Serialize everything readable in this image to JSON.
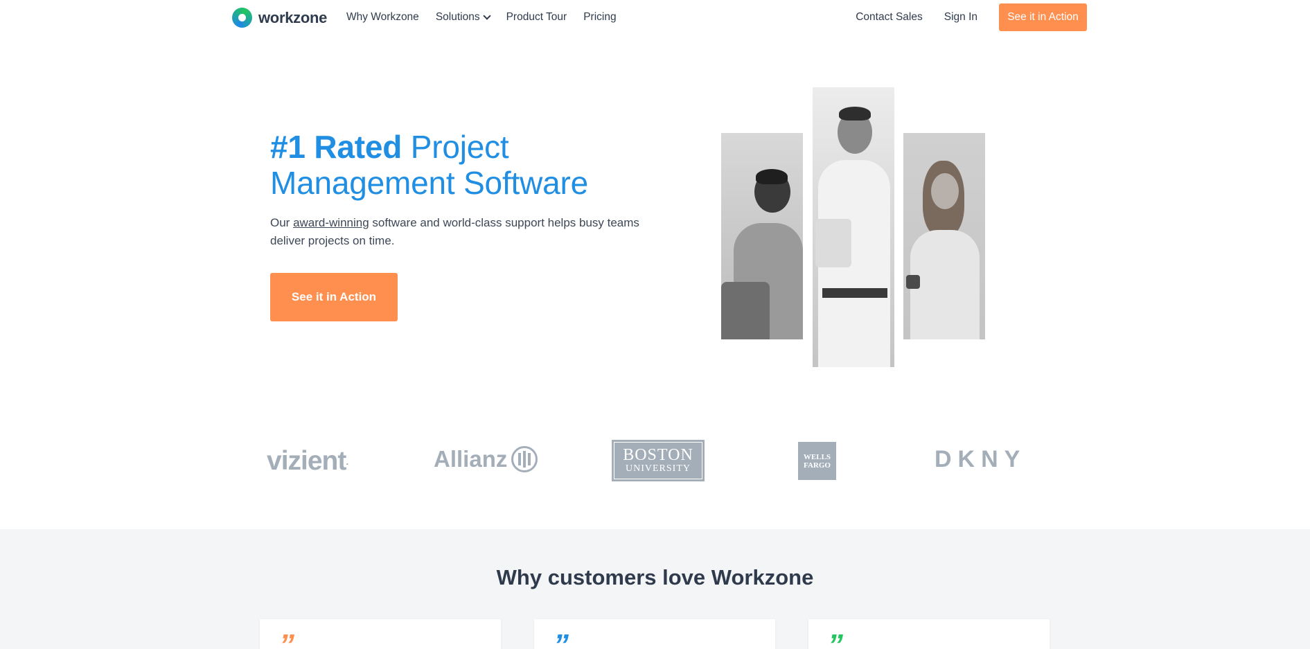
{
  "nav": {
    "brand": "workzone",
    "links": [
      {
        "label": "Why Workzone"
      },
      {
        "label": "Solutions"
      },
      {
        "label": "Product Tour"
      },
      {
        "label": "Pricing"
      }
    ],
    "contact_sales": "Contact Sales",
    "sign_in": "Sign In",
    "cta": "See it in Action"
  },
  "hero": {
    "title_bold": "#1 Rated",
    "title_rest_line1": " Project",
    "title_line2": "Management Software",
    "sub_prefix": "Our ",
    "sub_link": "award-winning",
    "sub_suffix": " software and world-class support helps busy teams deliver projects on time.",
    "cta": "See it in Action"
  },
  "client_logos": {
    "vizient": "vizient",
    "vizient_tm": ".",
    "allianz": "Allianz",
    "boston_line1": "BOSTON",
    "boston_line2": "UNIVERSITY",
    "wells_line1": "WELLS",
    "wells_line2": "FARGO",
    "dkny": "DKNY"
  },
  "section": {
    "title": "Why customers love Workzone",
    "cards": [
      {
        "quote_mark": "”",
        "color": "#ff8f4f"
      },
      {
        "quote_mark": "”",
        "color": "#1f8ee3"
      },
      {
        "quote_mark": "”",
        "color": "#22c55e"
      }
    ]
  },
  "colors": {
    "brand_blue": "#1f8ee3",
    "cta_orange": "#ff8f4f",
    "text_dark": "#2f3b4c",
    "logo_gray": "#a3aeb9",
    "section_bg": "#f4f5f7"
  }
}
